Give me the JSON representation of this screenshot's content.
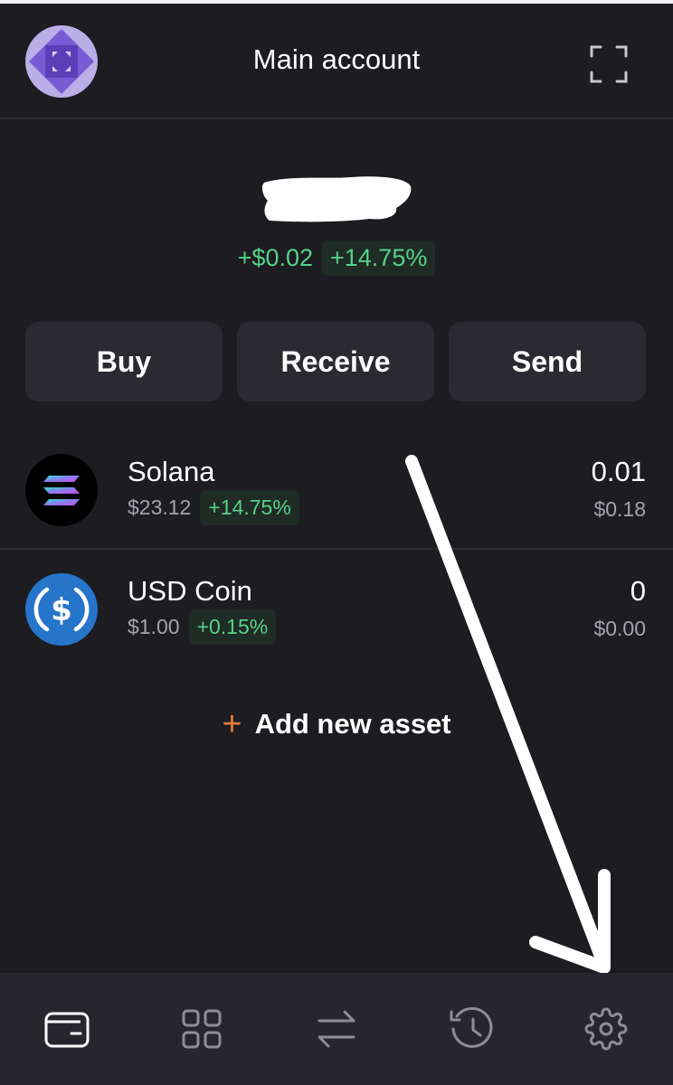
{
  "header": {
    "title": "Main account",
    "avatar_icon": "account-avatar-icon",
    "expand_icon": "fullscreen-icon"
  },
  "balance": {
    "change_amount": "+$0.02",
    "change_percent": "+14.75%"
  },
  "actions": {
    "buy": "Buy",
    "receive": "Receive",
    "send": "Send"
  },
  "assets": [
    {
      "name": "Solana",
      "price": "$23.12",
      "change": "+14.75%",
      "quantity": "0.01",
      "value": "$0.18",
      "icon": "solana-icon"
    },
    {
      "name": "USD Coin",
      "price": "$1.00",
      "change": "+0.15%",
      "quantity": "0",
      "value": "$0.00",
      "icon": "usdc-icon"
    }
  ],
  "add_asset": {
    "plus": "+",
    "label": "Add new asset"
  },
  "nav": {
    "items": [
      "wallet-icon",
      "apps-grid-icon",
      "swap-icon",
      "history-icon",
      "settings-icon"
    ],
    "active": "wallet-icon"
  },
  "colors": {
    "background": "#1c1c21",
    "positive": "#56d18a",
    "accent": "#e8793a",
    "button": "#2a2a30",
    "nav": "#26262c"
  }
}
